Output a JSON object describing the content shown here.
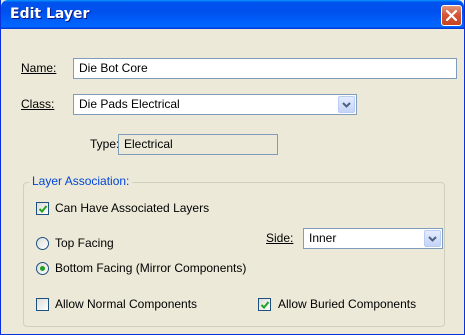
{
  "window": {
    "title": "Edit Layer"
  },
  "icons": {
    "close": "close-icon",
    "dropdown": "chevron-down-icon",
    "check": "checkmark-icon"
  },
  "colors": {
    "titlebar": "#0053ee",
    "groupTitle": "#0046d5",
    "radioDot": "#21a121"
  },
  "form": {
    "name_label": "Name:",
    "name_value": "Die Bot Core",
    "class_label": "Class:",
    "class_value": "Die Pads Electrical",
    "type_label": "Type:",
    "type_value": "Electrical"
  },
  "association": {
    "title": "Layer Association:",
    "can_have_label": "Can Have Associated Layers",
    "can_have_checked": true,
    "top_facing_label": "Top Facing",
    "top_facing_selected": false,
    "bottom_facing_label": "Bottom Facing (Mirror Components)",
    "bottom_facing_selected": true,
    "side_label": "Side:",
    "side_value": "Inner",
    "allow_normal_label": "Allow Normal Components",
    "allow_normal_checked": false,
    "allow_buried_label": "Allow Buried Components",
    "allow_buried_checked": true
  }
}
